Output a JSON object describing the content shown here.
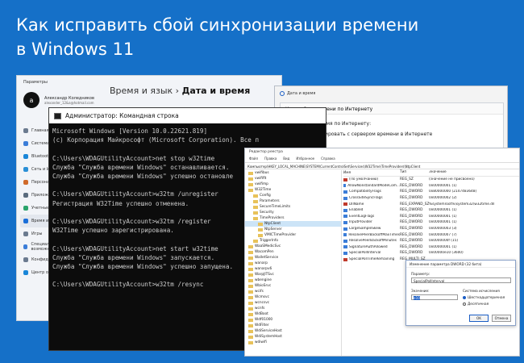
{
  "headline": {
    "line1": "Как исправить сбой синхронизации времени",
    "line2": "в Windows 11"
  },
  "settings": {
    "window_title": "Параметры",
    "user_name": "Александр Коледников",
    "user_email": "alexander_12&a@hotmail.com",
    "avatar_letter": "a",
    "breadcrumb_parent": "Время и язык",
    "breadcrumb_sep": "›",
    "breadcrumb_current": "Дата и время",
    "nav": [
      {
        "label": "Главная",
        "color": "#6b7a8f"
      },
      {
        "label": "Система",
        "color": "#3b7dd8"
      },
      {
        "label": "Bluetooth и устройства",
        "color": "#1a86d8"
      },
      {
        "label": "Сеть и Интернет",
        "color": "#2a8fd6"
      },
      {
        "label": "Персонализация",
        "color": "#d06a2a"
      },
      {
        "label": "Приложения",
        "color": "#5a6b7d"
      },
      {
        "label": "Учетные записи",
        "color": "#2aa36b"
      },
      {
        "label": "Время и язык",
        "color": "#1a6ed8",
        "active": true
      },
      {
        "label": "Игры",
        "color": "#6b7a8f"
      },
      {
        "label": "Специальные возможности",
        "color": "#3b7dd8"
      },
      {
        "label": "Конфиденциальность",
        "color": "#6b7a8f"
      },
      {
        "label": "Центр обновления",
        "color": "#1a86d8"
      }
    ]
  },
  "datetime": {
    "window_title": "Дата и время",
    "inner_title": "Настройка времени по Интернету",
    "label": "Настройте время по Интернету:",
    "checkbox_label": "Синхронизировать с сервером времени в Интернете"
  },
  "cmd": {
    "title": "Администратор: Командная строка",
    "lines": [
      "Microsoft Windows [Version 10.0.22621.819]",
      "(c) Корпорация Майкрософт (Microsoft Corporation). Все п",
      "",
      "C:\\Users\\WDAGUtilityAccount>net stop w32time",
      "Служба \"Служба времени Windows\" останавливается.",
      "Служба \"Служба времени Windows\" успешно остановле",
      "",
      "C:\\Users\\WDAGUtilityAccount>w32tm /unregister",
      "Регистрация W32Time успешно отменена.",
      "",
      "C:\\Users\\WDAGUtilityAccount>w32tm /register",
      "W32Time успешно зарегистрирована.",
      "",
      "C:\\Users\\WDAGUtilityAccount>net start w32time",
      "Служба \"Служба времени Windows\" запускается.",
      "Служба \"Служба времени Windows\" успешно запущена.",
      "",
      "C:\\Users\\WDAGUtilityAccount>w32tm /resync"
    ]
  },
  "registry": {
    "window_title": "Редактор реестра",
    "menu": [
      "Файл",
      "Правка",
      "Вид",
      "Избранное",
      "Справка"
    ],
    "path": "Компьютер\\HKEY_LOCAL_MACHINE\\SYSTEM\\CurrentControlSet\\Services\\W32Time\\TimeProviders\\NtpClient",
    "tree": [
      {
        "label": "vwifibus",
        "indent": 0
      },
      {
        "label": "vwififlt",
        "indent": 0
      },
      {
        "label": "vwifimp",
        "indent": 0
      },
      {
        "label": "W32Time",
        "indent": 0
      },
      {
        "label": "Config",
        "indent": 1
      },
      {
        "label": "Parameters",
        "indent": 1
      },
      {
        "label": "SecureTimeLimits",
        "indent": 1
      },
      {
        "label": "Security",
        "indent": 1
      },
      {
        "label": "TimeProviders",
        "indent": 1
      },
      {
        "label": "NtpClient",
        "indent": 2,
        "selected": true
      },
      {
        "label": "NtpServer",
        "indent": 2
      },
      {
        "label": "VMICTimeProvider",
        "indent": 2
      },
      {
        "label": "TriggerInfo",
        "indent": 1
      },
      {
        "label": "WaaSMedicSvc",
        "indent": 0
      },
      {
        "label": "WacomPen",
        "indent": 0
      },
      {
        "label": "WalletService",
        "indent": 0
      },
      {
        "label": "wanarp",
        "indent": 0
      },
      {
        "label": "wanarpv6",
        "indent": 0
      },
      {
        "label": "WarpJITSvc",
        "indent": 0
      },
      {
        "label": "wbengine",
        "indent": 0
      },
      {
        "label": "WbioSrvc",
        "indent": 0
      },
      {
        "label": "wcifs",
        "indent": 0
      },
      {
        "label": "Wcmsvc",
        "indent": 0
      },
      {
        "label": "wcncsvc",
        "indent": 0
      },
      {
        "label": "wcnfs",
        "indent": 0
      },
      {
        "label": "WdBoot",
        "indent": 0
      },
      {
        "label": "Wdf01000",
        "indent": 0
      },
      {
        "label": "WdFilter",
        "indent": 0
      },
      {
        "label": "WdiServiceHost",
        "indent": 0
      },
      {
        "label": "WdiSystemHost",
        "indent": 0
      },
      {
        "label": "wdiwifi",
        "indent": 0
      }
    ],
    "columns": [
      "Имя",
      "Тип",
      "Значение"
    ],
    "values": [
      {
        "name": "(По умолчанию)",
        "type": "REG_SZ",
        "value": "(значение не присвоено)",
        "kind": "sz"
      },
      {
        "name": "AllowNonstandardModeCom...",
        "type": "REG_DWORD",
        "value": "0x00000001 (1)",
        "kind": "dw"
      },
      {
        "name": "CompatibilityFlags",
        "type": "REG_DWORD",
        "value": "0x80000000 (2147483648)",
        "kind": "dw"
      },
      {
        "name": "CrossSiteSyncFlags",
        "type": "REG_DWORD",
        "value": "0x00000002 (2)",
        "kind": "dw"
      },
      {
        "name": "DllName",
        "type": "REG_EXPAND_SZ",
        "value": "%systemroot%\\system32\\w32time.dll",
        "kind": "sz"
      },
      {
        "name": "Enabled",
        "type": "REG_DWORD",
        "value": "0x00000001 (1)",
        "kind": "dw"
      },
      {
        "name": "EventLogFlags",
        "type": "REG_DWORD",
        "value": "0x00000001 (1)",
        "kind": "dw"
      },
      {
        "name": "InputProvider",
        "type": "REG_DWORD",
        "value": "0x00000001 (1)",
        "kind": "dw"
      },
      {
        "name": "LargeSampleSkew",
        "type": "REG_DWORD",
        "value": "0x00000003 (3)",
        "kind": "dw"
      },
      {
        "name": "ResolvePeerBackoffMaxTimes",
        "type": "REG_DWORD",
        "value": "0x00000007 (7)",
        "kind": "dw"
      },
      {
        "name": "ResolvePeerBackoffMinutes",
        "type": "REG_DWORD",
        "value": "0x0000000f (15)",
        "kind": "dw"
      },
      {
        "name": "SignatureAuthAllowed",
        "type": "REG_DWORD",
        "value": "0x00000001 (1)",
        "kind": "dw"
      },
      {
        "name": "SpecialPollInterval",
        "type": "REG_DWORD",
        "value": "0x00000e10 (3600)",
        "kind": "dw"
      },
      {
        "name": "SpecialPollTimeRemaining",
        "type": "REG_MULTI_SZ",
        "value": "",
        "kind": "sz"
      }
    ]
  },
  "edit_dialog": {
    "title": "Изменение параметра DWORD (32 бита)",
    "param_label": "Параметр:",
    "param_value": "SpecialPollInterval",
    "value_label": "Значение:",
    "value": "e10",
    "base_label": "Система исчисления",
    "radio_hex": "Шестнадцатеричная",
    "radio_dec": "Десятичная",
    "ok": "OK",
    "cancel": "Отмена"
  }
}
